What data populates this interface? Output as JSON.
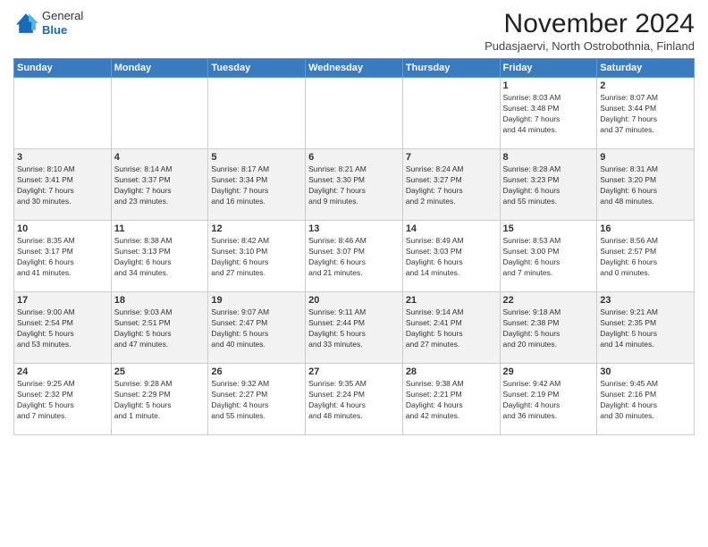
{
  "logo": {
    "general": "General",
    "blue": "Blue"
  },
  "title": "November 2024",
  "location": "Pudasjaervi, North Ostrobothnia, Finland",
  "days_header": [
    "Sunday",
    "Monday",
    "Tuesday",
    "Wednesday",
    "Thursday",
    "Friday",
    "Saturday"
  ],
  "weeks": [
    [
      {
        "day": "",
        "info": ""
      },
      {
        "day": "",
        "info": ""
      },
      {
        "day": "",
        "info": ""
      },
      {
        "day": "",
        "info": ""
      },
      {
        "day": "",
        "info": ""
      },
      {
        "day": "1",
        "info": "Sunrise: 8:03 AM\nSunset: 3:48 PM\nDaylight: 7 hours\nand 44 minutes."
      },
      {
        "day": "2",
        "info": "Sunrise: 8:07 AM\nSunset: 3:44 PM\nDaylight: 7 hours\nand 37 minutes."
      }
    ],
    [
      {
        "day": "3",
        "info": "Sunrise: 8:10 AM\nSunset: 3:41 PM\nDaylight: 7 hours\nand 30 minutes."
      },
      {
        "day": "4",
        "info": "Sunrise: 8:14 AM\nSunset: 3:37 PM\nDaylight: 7 hours\nand 23 minutes."
      },
      {
        "day": "5",
        "info": "Sunrise: 8:17 AM\nSunset: 3:34 PM\nDaylight: 7 hours\nand 16 minutes."
      },
      {
        "day": "6",
        "info": "Sunrise: 8:21 AM\nSunset: 3:30 PM\nDaylight: 7 hours\nand 9 minutes."
      },
      {
        "day": "7",
        "info": "Sunrise: 8:24 AM\nSunset: 3:27 PM\nDaylight: 7 hours\nand 2 minutes."
      },
      {
        "day": "8",
        "info": "Sunrise: 8:28 AM\nSunset: 3:23 PM\nDaylight: 6 hours\nand 55 minutes."
      },
      {
        "day": "9",
        "info": "Sunrise: 8:31 AM\nSunset: 3:20 PM\nDaylight: 6 hours\nand 48 minutes."
      }
    ],
    [
      {
        "day": "10",
        "info": "Sunrise: 8:35 AM\nSunset: 3:17 PM\nDaylight: 6 hours\nand 41 minutes."
      },
      {
        "day": "11",
        "info": "Sunrise: 8:38 AM\nSunset: 3:13 PM\nDaylight: 6 hours\nand 34 minutes."
      },
      {
        "day": "12",
        "info": "Sunrise: 8:42 AM\nSunset: 3:10 PM\nDaylight: 6 hours\nand 27 minutes."
      },
      {
        "day": "13",
        "info": "Sunrise: 8:46 AM\nSunset: 3:07 PM\nDaylight: 6 hours\nand 21 minutes."
      },
      {
        "day": "14",
        "info": "Sunrise: 8:49 AM\nSunset: 3:03 PM\nDaylight: 6 hours\nand 14 minutes."
      },
      {
        "day": "15",
        "info": "Sunrise: 8:53 AM\nSunset: 3:00 PM\nDaylight: 6 hours\nand 7 minutes."
      },
      {
        "day": "16",
        "info": "Sunrise: 8:56 AM\nSunset: 2:57 PM\nDaylight: 6 hours\nand 0 minutes."
      }
    ],
    [
      {
        "day": "17",
        "info": "Sunrise: 9:00 AM\nSunset: 2:54 PM\nDaylight: 5 hours\nand 53 minutes."
      },
      {
        "day": "18",
        "info": "Sunrise: 9:03 AM\nSunset: 2:51 PM\nDaylight: 5 hours\nand 47 minutes."
      },
      {
        "day": "19",
        "info": "Sunrise: 9:07 AM\nSunset: 2:47 PM\nDaylight: 5 hours\nand 40 minutes."
      },
      {
        "day": "20",
        "info": "Sunrise: 9:11 AM\nSunset: 2:44 PM\nDaylight: 5 hours\nand 33 minutes."
      },
      {
        "day": "21",
        "info": "Sunrise: 9:14 AM\nSunset: 2:41 PM\nDaylight: 5 hours\nand 27 minutes."
      },
      {
        "day": "22",
        "info": "Sunrise: 9:18 AM\nSunset: 2:38 PM\nDaylight: 5 hours\nand 20 minutes."
      },
      {
        "day": "23",
        "info": "Sunrise: 9:21 AM\nSunset: 2:35 PM\nDaylight: 5 hours\nand 14 minutes."
      }
    ],
    [
      {
        "day": "24",
        "info": "Sunrise: 9:25 AM\nSunset: 2:32 PM\nDaylight: 5 hours\nand 7 minutes."
      },
      {
        "day": "25",
        "info": "Sunrise: 9:28 AM\nSunset: 2:29 PM\nDaylight: 5 hours\nand 1 minute."
      },
      {
        "day": "26",
        "info": "Sunrise: 9:32 AM\nSunset: 2:27 PM\nDaylight: 4 hours\nand 55 minutes."
      },
      {
        "day": "27",
        "info": "Sunrise: 9:35 AM\nSunset: 2:24 PM\nDaylight: 4 hours\nand 48 minutes."
      },
      {
        "day": "28",
        "info": "Sunrise: 9:38 AM\nSunset: 2:21 PM\nDaylight: 4 hours\nand 42 minutes."
      },
      {
        "day": "29",
        "info": "Sunrise: 9:42 AM\nSunset: 2:19 PM\nDaylight: 4 hours\nand 36 minutes."
      },
      {
        "day": "30",
        "info": "Sunrise: 9:45 AM\nSunset: 2:16 PM\nDaylight: 4 hours\nand 30 minutes."
      }
    ]
  ]
}
